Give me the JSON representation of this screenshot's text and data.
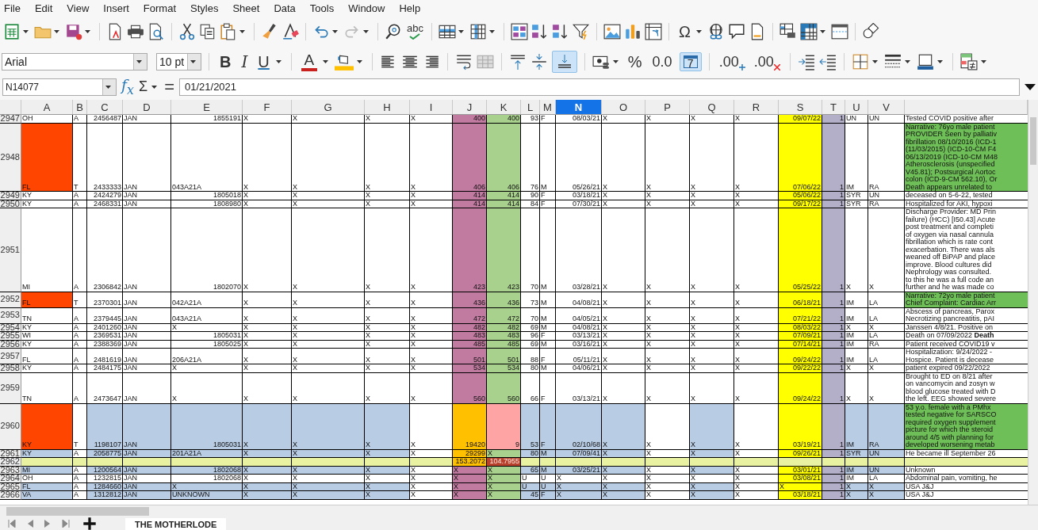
{
  "menu": [
    "File",
    "Edit",
    "View",
    "Insert",
    "Format",
    "Styles",
    "Sheet",
    "Data",
    "Tools",
    "Window",
    "Help"
  ],
  "standard_toolbar": {
    "redo": {
      "disabled": true
    },
    "spelling_glyph": "abc",
    "special_character_glyph": "Ω"
  },
  "format_toolbar": {
    "font_name": "Arial",
    "font_size": "10 pt",
    "bold": "B",
    "italic": "I",
    "underline": "U",
    "font_color": "A",
    "align_bottom": {
      "on": true
    },
    "percent": "%",
    "number_format": "0.0",
    "date_format": {
      "glyph": "7",
      "on": true
    },
    "add_decimal": ".00",
    "delete_decimal": ".00"
  },
  "formula_bar": {
    "name_box": "N14077",
    "function_glyph": "f$_{x}$",
    "sum_glyph": "Σ",
    "equals_glyph": "=",
    "value": "01/21/2021"
  },
  "columns": [
    {
      "label": "A",
      "selected": false
    },
    {
      "label": "B",
      "selected": false
    },
    {
      "label": "C",
      "selected": false
    },
    {
      "label": "D",
      "selected": false
    },
    {
      "label": "E",
      "selected": false
    },
    {
      "label": "F",
      "selected": false
    },
    {
      "label": "G",
      "selected": false
    },
    {
      "label": "H",
      "selected": false
    },
    {
      "label": "I",
      "selected": false
    },
    {
      "label": "J",
      "selected": false
    },
    {
      "label": "K",
      "selected": false
    },
    {
      "label": "L",
      "selected": false
    },
    {
      "label": "M",
      "selected": false
    },
    {
      "label": "N",
      "selected": true
    },
    {
      "label": "O",
      "selected": false
    },
    {
      "label": "P",
      "selected": false
    },
    {
      "label": "Q",
      "selected": false
    },
    {
      "label": "R",
      "selected": false
    },
    {
      "label": "S",
      "selected": false
    },
    {
      "label": "T",
      "selected": false
    },
    {
      "label": "U",
      "selected": false
    },
    {
      "label": "V",
      "selected": false
    }
  ],
  "rows": [
    {
      "number": "2947",
      "flagged": false,
      "shaded": false,
      "kind": "standard",
      "note_highlight": false,
      "cells": {
        "A": "OH",
        "B": "A",
        "C": "2456487",
        "D": "JAN",
        "E": "1855191",
        "F": "X",
        "G": "X",
        "H": "X",
        "I": "X",
        "J": "400",
        "K": "400",
        "L": "93",
        "M": "F",
        "N": "08/03/21",
        "O": "X",
        "P": "X",
        "Q": "X",
        "R": "X",
        "S": "09/07/22",
        "T": "1",
        "U": "UN",
        "V": "UN"
      },
      "note": [
        "Tested COVID positive after"
      ]
    },
    {
      "number": "2948",
      "flagged": true,
      "shaded": false,
      "kind": "standard",
      "note_highlight": true,
      "cells": {
        "A": "FL",
        "B": "T",
        "C": "2433333",
        "D": "JAN",
        "E": "043A21A",
        "F": "X",
        "G": "X",
        "H": "X",
        "I": "X",
        "J": "406",
        "K": "406",
        "L": "76",
        "M": "M",
        "N": "05/26/21",
        "O": "X",
        "P": "X",
        "Q": "X",
        "R": "X",
        "S": "07/06/22",
        "T": "1",
        "U": "IM",
        "V": "RA"
      },
      "note": [
        "Narrative: 76yo male patient",
        "PROVIDER Seen by palliativ",
        "fibrillation 08/10/2016 (ICD-1",
        "(11/03/2015) (ICD-10-CM F4",
        "06/13/2019 (ICD-10-CM M48",
        "Atherosclerosis (unspecified",
        "V45.81); Postsurgical Aortoc",
        "colon (ICD-9-CM 562.10), Or",
        "Death appears unrelated to"
      ]
    },
    {
      "number": "2949",
      "flagged": false,
      "shaded": false,
      "kind": "standard",
      "note_highlight": false,
      "cells": {
        "A": "KY",
        "B": "A",
        "C": "2424279",
        "D": "JAN",
        "E": "1805018",
        "F": "X",
        "G": "X",
        "H": "X",
        "I": "X",
        "J": "414",
        "K": "414",
        "L": "90",
        "M": "F",
        "N": "03/18/21",
        "O": "X",
        "P": "X",
        "Q": "X",
        "R": "X",
        "S": "05/06/22",
        "T": "1",
        "U": "SYR",
        "V": "UN"
      },
      "note": [
        "deceased on 5-6-22, tested"
      ]
    },
    {
      "number": "2950",
      "flagged": false,
      "shaded": false,
      "kind": "standard",
      "note_highlight": false,
      "cells": {
        "A": "KY",
        "B": "A",
        "C": "2468331",
        "D": "JAN",
        "E": "1808980",
        "F": "X",
        "G": "X",
        "H": "X",
        "I": "X",
        "J": "414",
        "K": "414",
        "L": "84",
        "M": "F",
        "N": "07/30/21",
        "O": "X",
        "P": "X",
        "Q": "X",
        "R": "X",
        "S": "09/17/22",
        "T": "1",
        "U": "SYR",
        "V": "RA"
      },
      "note": [
        "Hospitalized for AKI, hypoxi"
      ]
    },
    {
      "number": "2951",
      "flagged": false,
      "shaded": false,
      "kind": "standard",
      "note_highlight": false,
      "cells": {
        "A": "MI",
        "B": "A",
        "C": "2306842",
        "D": "JAN",
        "E": "1802070",
        "F": "X",
        "G": "X",
        "H": "X",
        "I": "X",
        "J": "423",
        "K": "423",
        "L": "70",
        "M": "M",
        "N": "03/28/21",
        "O": "X",
        "P": "X",
        "Q": "X",
        "R": "X",
        "S": "05/25/22",
        "T": "1",
        "U": "X",
        "V": "X"
      },
      "note": [
        "Discharge Provider: MD Prin",
        "failure) (HCC) [I50.43] Acute",
        "post treatment and completi",
        "of oxygen via nasal cannula",
        "fibrillation which is rate cont",
        "exacerbation. There was als",
        "weaned off BiPAP and place",
        "improve. Blood cultures did",
        "Nephrology was consulted.",
        "to this he was a full code an",
        "further and he was made co"
      ]
    },
    {
      "number": "2952",
      "flagged": true,
      "shaded": false,
      "kind": "standard",
      "note_highlight": true,
      "cells": {
        "A": "FL",
        "B": "T",
        "C": "2370301",
        "D": "JAN",
        "E": "042A21A",
        "F": "X",
        "G": "X",
        "H": "X",
        "I": "X",
        "J": "436",
        "K": "436",
        "L": "73",
        "M": "M",
        "N": "04/08/21",
        "O": "X",
        "P": "X",
        "Q": "X",
        "R": "X",
        "S": "06/18/21",
        "T": "1",
        "U": "IM",
        "V": "LA"
      },
      "note": [
        "Narrative: 72yo male patient",
        "Chief Complaint: Cardiac Arr"
      ]
    },
    {
      "number": "2953",
      "flagged": false,
      "shaded": false,
      "kind": "standard",
      "note_highlight": false,
      "cells": {
        "A": "TN",
        "B": "A",
        "C": "2379445",
        "D": "JAN",
        "E": "043A21A",
        "F": "X",
        "G": "X",
        "H": "X",
        "I": "X",
        "J": "472",
        "K": "472",
        "L": "70",
        "M": "M",
        "N": "04/05/21",
        "O": "X",
        "P": "X",
        "Q": "X",
        "R": "X",
        "S": "07/21/22",
        "T": "1",
        "U": "IM",
        "V": "LA"
      },
      "note": [
        "Abscess of pancreas, Parox",
        "Necrotizing pancreatitis, pAI"
      ]
    },
    {
      "number": "2954",
      "flagged": false,
      "shaded": false,
      "kind": "standard",
      "note_highlight": false,
      "cells": {
        "A": "KY",
        "B": "A",
        "C": "2401260",
        "D": "JAN",
        "E": "X",
        "F": "X",
        "G": "X",
        "H": "X",
        "I": "X",
        "J": "482",
        "K": "482",
        "L": "69",
        "M": "M",
        "N": "04/08/21",
        "O": "X",
        "P": "X",
        "Q": "X",
        "R": "X",
        "S": "08/03/22",
        "T": "1",
        "U": "X",
        "V": "X"
      },
      "note": [
        "Janssen 4/8/21. Positive on"
      ]
    },
    {
      "number": "2955",
      "flagged": false,
      "shaded": false,
      "kind": "standard",
      "note_highlight": false,
      "cells": {
        "A": "WI",
        "B": "A",
        "C": "2369531",
        "D": "JAN",
        "E": "1805031",
        "F": "X",
        "G": "X",
        "H": "X",
        "I": "X",
        "J": "483",
        "K": "483",
        "L": "96",
        "M": "F",
        "N": "03/13/21",
        "O": "X",
        "P": "X",
        "Q": "X",
        "R": "X",
        "S": "07/09/21",
        "T": "1",
        "U": "IM",
        "V": "LA"
      },
      "note": [
        "Death on 07/09/2022 **Death**"
      ]
    },
    {
      "number": "2956",
      "flagged": false,
      "shaded": false,
      "kind": "standard",
      "note_highlight": false,
      "cells": {
        "A": "KY",
        "B": "A",
        "C": "2388369",
        "D": "JAN",
        "E": "1805025",
        "F": "X",
        "G": "X",
        "H": "X",
        "I": "X",
        "J": "485",
        "K": "485",
        "L": "69",
        "M": "M",
        "N": "03/16/21",
        "O": "X",
        "P": "X",
        "Q": "X",
        "R": "X",
        "S": "07/14/21",
        "T": "1",
        "U": "IM",
        "V": "RA"
      },
      "note": [
        "Patient received COVID19 v"
      ]
    },
    {
      "number": "2957",
      "flagged": false,
      "shaded": false,
      "kind": "standard",
      "note_highlight": false,
      "cells": {
        "A": "FL",
        "B": "A",
        "C": "2481619",
        "D": "JAN",
        "E": "206A21A",
        "F": "X",
        "G": "X",
        "H": "X",
        "I": "X",
        "J": "501",
        "K": "501",
        "L": "88",
        "M": "F",
        "N": "05/11/21",
        "O": "X",
        "P": "X",
        "Q": "X",
        "R": "X",
        "S": "09/24/22",
        "T": "1",
        "U": "IM",
        "V": "LA"
      },
      "note": [
        "Hospitalization: 9/24/2022 -",
        "Hospice. Patient is decease"
      ]
    },
    {
      "number": "2958",
      "flagged": false,
      "shaded": false,
      "kind": "standard",
      "note_highlight": false,
      "cells": {
        "A": "KY",
        "B": "A",
        "C": "2484175",
        "D": "JAN",
        "E": "X",
        "F": "X",
        "G": "X",
        "H": "X",
        "I": "X",
        "J": "534",
        "K": "534",
        "L": "80",
        "M": "M",
        "N": "04/06/21",
        "O": "X",
        "P": "X",
        "Q": "X",
        "R": "X",
        "S": "09/22/22",
        "T": "1",
        "U": "X",
        "V": "X"
      },
      "note": [
        "patient expired 09/22/2022"
      ]
    },
    {
      "number": "2959",
      "flagged": false,
      "shaded": false,
      "kind": "standard",
      "note_highlight": false,
      "cells": {
        "A": "TN",
        "B": "A",
        "C": "2473647",
        "D": "JAN",
        "E": "X",
        "F": "X",
        "G": "X",
        "H": "X",
        "I": "X",
        "J": "560",
        "K": "560",
        "L": "66",
        "M": "F",
        "N": "03/13/21",
        "O": "X",
        "P": "X",
        "Q": "X",
        "R": "X",
        "S": "09/24/22",
        "T": "1",
        "U": "X",
        "V": "X"
      },
      "note": [
        "Brought to ED on 8/21 after",
        "on vancomycin and zosyn w",
        "blood glucose treated with D",
        "the left. EEG showed severe"
      ]
    },
    {
      "number": "2960",
      "flagged": true,
      "shaded": true,
      "kind": "peak",
      "note_highlight": true,
      "cells": {
        "A": "KY",
        "B": "T",
        "C": "1198107",
        "D": "JAN",
        "E": "1805031",
        "F": "X",
        "G": "X",
        "H": "X",
        "I": "X",
        "J": "19420",
        "K": "9",
        "L": "53",
        "M": "F",
        "N": "02/10/68",
        "O": "X",
        "P": "X",
        "Q": "X",
        "R": "X",
        "S": "03/19/21",
        "T": "1",
        "U": "IM",
        "V": "RA"
      },
      "note": [
        "53 y.o. female with a PMhx",
        "tested negative for SARSCO",
        "required oxygen supplement",
        "picture for which the steroid",
        "around 4/5 with planning for",
        "developed worsening metab"
      ]
    },
    {
      "number": "2961",
      "flagged": false,
      "shaded": true,
      "kind": "partial",
      "note_highlight": false,
      "cells": {
        "A": "KY",
        "B": "A",
        "C": "2058775",
        "D": "JAN",
        "E": "201A21A",
        "F": "X",
        "G": "X",
        "H": "X",
        "I": "X",
        "J": "29299",
        "K": "X",
        "L": "80",
        "M": "M",
        "N": "07/09/41",
        "O": "X",
        "P": "X",
        "Q": "X",
        "R": "X",
        "S": "09/26/21",
        "T": "1",
        "U": "SYR",
        "V": "UN"
      },
      "note": [
        "He became ill September 26"
      ]
    },
    {
      "number": "2962",
      "flagged": false,
      "kind": "total",
      "note_highlight": false,
      "cells": {
        "J": "153.2072",
        "K": "104.7955"
      }
    },
    {
      "number": "2963",
      "flagged": false,
      "shaded": true,
      "kind": "standard",
      "note_highlight": false,
      "cells": {
        "A": "MI",
        "B": "A",
        "C": "1200564",
        "D": "JAN",
        "E": "1802068",
        "F": "X",
        "G": "X",
        "H": "X",
        "I": "X",
        "J": "X",
        "K": "X",
        "L": "65",
        "M": "M",
        "N": "03/25/21",
        "O": "X",
        "P": "X",
        "Q": "X",
        "R": "X",
        "S": "03/01/21",
        "T": "1",
        "U": "IM",
        "V": "UN"
      },
      "note": [
        "Unknown"
      ]
    },
    {
      "number": "2964",
      "flagged": false,
      "shaded": false,
      "kind": "standard",
      "note_highlight": false,
      "cells": {
        "A": "OH",
        "B": "A",
        "C": "1232815",
        "D": "JAN",
        "E": "1802068",
        "F": "X",
        "G": "X",
        "H": "X",
        "I": "X",
        "J": "X",
        "K": "X",
        "L": "U",
        "M": "U",
        "N": "X",
        "O": "X",
        "P": "X",
        "Q": "X",
        "R": "X",
        "S": "03/08/21",
        "T": "1",
        "U": "IM",
        "V": "LA"
      },
      "note": [
        "Abdominal pain, vomiting, he"
      ]
    },
    {
      "number": "2965",
      "flagged": false,
      "shaded": true,
      "kind": "standard",
      "note_highlight": false,
      "cells": {
        "A": "FL",
        "B": "A",
        "C": "1284660",
        "D": "JAN",
        "E": "X",
        "F": "X",
        "G": "X",
        "H": "X",
        "I": "X",
        "J": "X",
        "K": "X",
        "L": "U",
        "M": "U",
        "N": "X",
        "O": "X",
        "P": "X",
        "Q": "X",
        "R": "X",
        "S": "X",
        "T": "1",
        "U": "X",
        "V": "X"
      },
      "note": [
        "USA J&J"
      ]
    },
    {
      "number": "2966",
      "flagged": false,
      "shaded": true,
      "kind": "standard",
      "note_highlight": false,
      "cells": {
        "A": "VA",
        "B": "A",
        "C": "1312812",
        "D": "JAN",
        "E": "UNKNOWN",
        "F": "X",
        "G": "X",
        "H": "X",
        "I": "X",
        "J": "X",
        "K": "X",
        "L": "45",
        "M": "F",
        "N": "X",
        "O": "X",
        "P": "X",
        "Q": "X",
        "R": "X",
        "S": "03/18/21",
        "T": "1",
        "U": "X",
        "V": "X"
      },
      "note": [
        "USA J&J"
      ]
    }
  ],
  "sheet_tabs": [
    {
      "label": "THE MOTHERLODE",
      "selected": true
    }
  ]
}
